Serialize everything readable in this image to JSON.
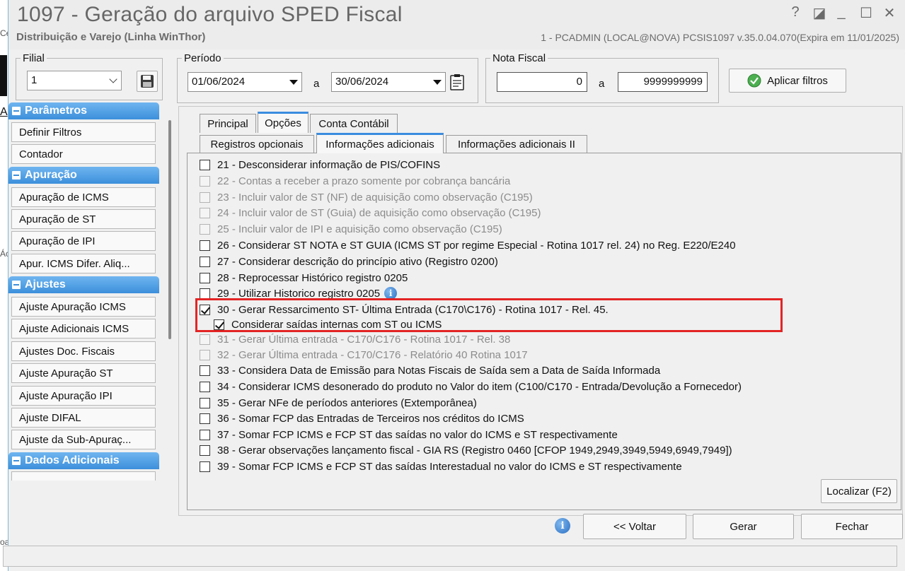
{
  "background": {
    "texts": [
      "Ce",
      "A",
      "Ác",
      "oa"
    ]
  },
  "window": {
    "title": "1097 - Geração do arquivo SPED Fiscal",
    "subtitle": "Distribuição e Varejo (Linha WinThor)",
    "info": "1 - PCADMIN (LOCAL@NOVA)   PCSIS1097  v.35.0.04.070(Expira em 11/01/2025)",
    "controls": {
      "help": "?",
      "restore": "◪",
      "minimize": "_",
      "maximize": "☐",
      "close": "✕"
    }
  },
  "filial": {
    "legend": "Filial",
    "value": "1"
  },
  "periodo": {
    "legend": "Período",
    "from": "01/06/2024",
    "sep": "a",
    "to": "30/06/2024"
  },
  "nota_fiscal": {
    "legend": "Nota Fiscal",
    "from": "0",
    "sep": "a",
    "to": "9999999999"
  },
  "apply_button": "Aplicar filtros",
  "sidebar": {
    "sections": [
      {
        "title": "Parâmetros",
        "items": [
          "Definir Filtros",
          "Contador"
        ]
      },
      {
        "title": "Apuração",
        "items": [
          "Apuração de ICMS",
          "Apuração de ST",
          "Apuração de IPI",
          "Apur. ICMS Difer. Aliq..."
        ]
      },
      {
        "title": "Ajustes",
        "items": [
          "Ajuste Apuração ICMS",
          "Ajuste Adicionais ICMS",
          "Ajustes Doc. Fiscais",
          "Ajuste Apuração ST",
          "Ajuste Apuração IPI",
          "Ajuste DIFAL",
          "Ajuste da Sub-Apuraç..."
        ]
      },
      {
        "title": "Dados Adicionais",
        "items": [
          ""
        ]
      }
    ]
  },
  "tabs_top": [
    "Principal",
    "Opções",
    "Conta Contábil"
  ],
  "tabs_sub": [
    "Registros opcionais",
    "Informações adicionais",
    "Informações adicionais II"
  ],
  "options": [
    {
      "label": "21 - Desconsiderar informação de PIS/COFINS",
      "checked": false,
      "disabled": false
    },
    {
      "label": "22 - Contas a receber a prazo somente por cobrança bancária",
      "checked": false,
      "disabled": true
    },
    {
      "label": "23 - Incluir valor de ST (NF) de aquisição como observação (C195)",
      "checked": false,
      "disabled": true
    },
    {
      "label": "24 - Incluir valor de ST (Guia) de aquisição como observação (C195)",
      "checked": false,
      "disabled": true
    },
    {
      "label": "25 - Incluir valor de IPI e aquisição como observação (C195)",
      "checked": false,
      "disabled": true
    },
    {
      "label": "26 - Considerar ST NOTA e ST GUIA (ICMS ST por regime Especial - Rotina 1017 rel. 24) no Reg. E220/E240",
      "checked": false,
      "disabled": false
    },
    {
      "label": "27 - Considerar descrição do princípio ativo (Registro 0200)",
      "checked": false,
      "disabled": false
    },
    {
      "label": "28 - Reprocessar Histórico registro 0205",
      "checked": false,
      "disabled": false
    },
    {
      "label": "29 - Utilizar Historico registro 0205",
      "checked": false,
      "disabled": false,
      "info_icon": "i"
    },
    {
      "label": "30 - Gerar Ressarcimento ST- Última Entrada (C170\\C176) - Rotina 1017 - Rel. 45.",
      "checked": true,
      "disabled": false
    },
    {
      "label": "Considerar saídas internas com ST ou ICMS",
      "checked": true,
      "disabled": false,
      "indent": true
    },
    {
      "label": "31 - Gerar Última entrada - C170/C176 - Rotina 1017 - Rel. 38",
      "checked": false,
      "disabled": true
    },
    {
      "label": "32 - Gerar Última entrada - C170/C176 - Relatório 40 Rotina 1017",
      "checked": false,
      "disabled": true
    },
    {
      "label": "33 - Considera Data de Emissão para Notas Fiscais de Saída sem a Data de Saída Informada",
      "checked": false,
      "disabled": false
    },
    {
      "label": "34 - Considerar ICMS desonerado do produto no Valor do item (C100/C170 - Entrada/Devolução a Fornecedor)",
      "checked": false,
      "disabled": false
    },
    {
      "label": "35 - Gerar NFe de períodos anteriores (Extemporânea)",
      "checked": false,
      "disabled": false
    },
    {
      "label": "36 - Somar FCP das Entradas de Terceiros nos créditos do ICMS",
      "checked": false,
      "disabled": false
    },
    {
      "label": "37 - Somar FCP ICMS e FCP ST das saídas no valor do ICMS e ST respectivamente",
      "checked": false,
      "disabled": false
    },
    {
      "label": "38 - Gerar observações lançamento fiscal - GIA RS (Registro 0460 [CFOP 1949,2949,3949,5949,6949,7949])",
      "checked": false,
      "disabled": false
    },
    {
      "label": "39 - Somar FCP ICMS e FCP ST das saídas Interestadual no valor do ICMS e ST respectivamente",
      "checked": false,
      "disabled": false
    }
  ],
  "localizar_button": "Localizar (F2)",
  "footer": {
    "info_icon": "i",
    "voltar": "<< Voltar",
    "gerar": "Gerar",
    "fechar": "Fechar"
  },
  "colors": {
    "accent": "#3a8de0",
    "highlight_box": "#e32424",
    "sidebar_header": "#3c8fdb"
  }
}
